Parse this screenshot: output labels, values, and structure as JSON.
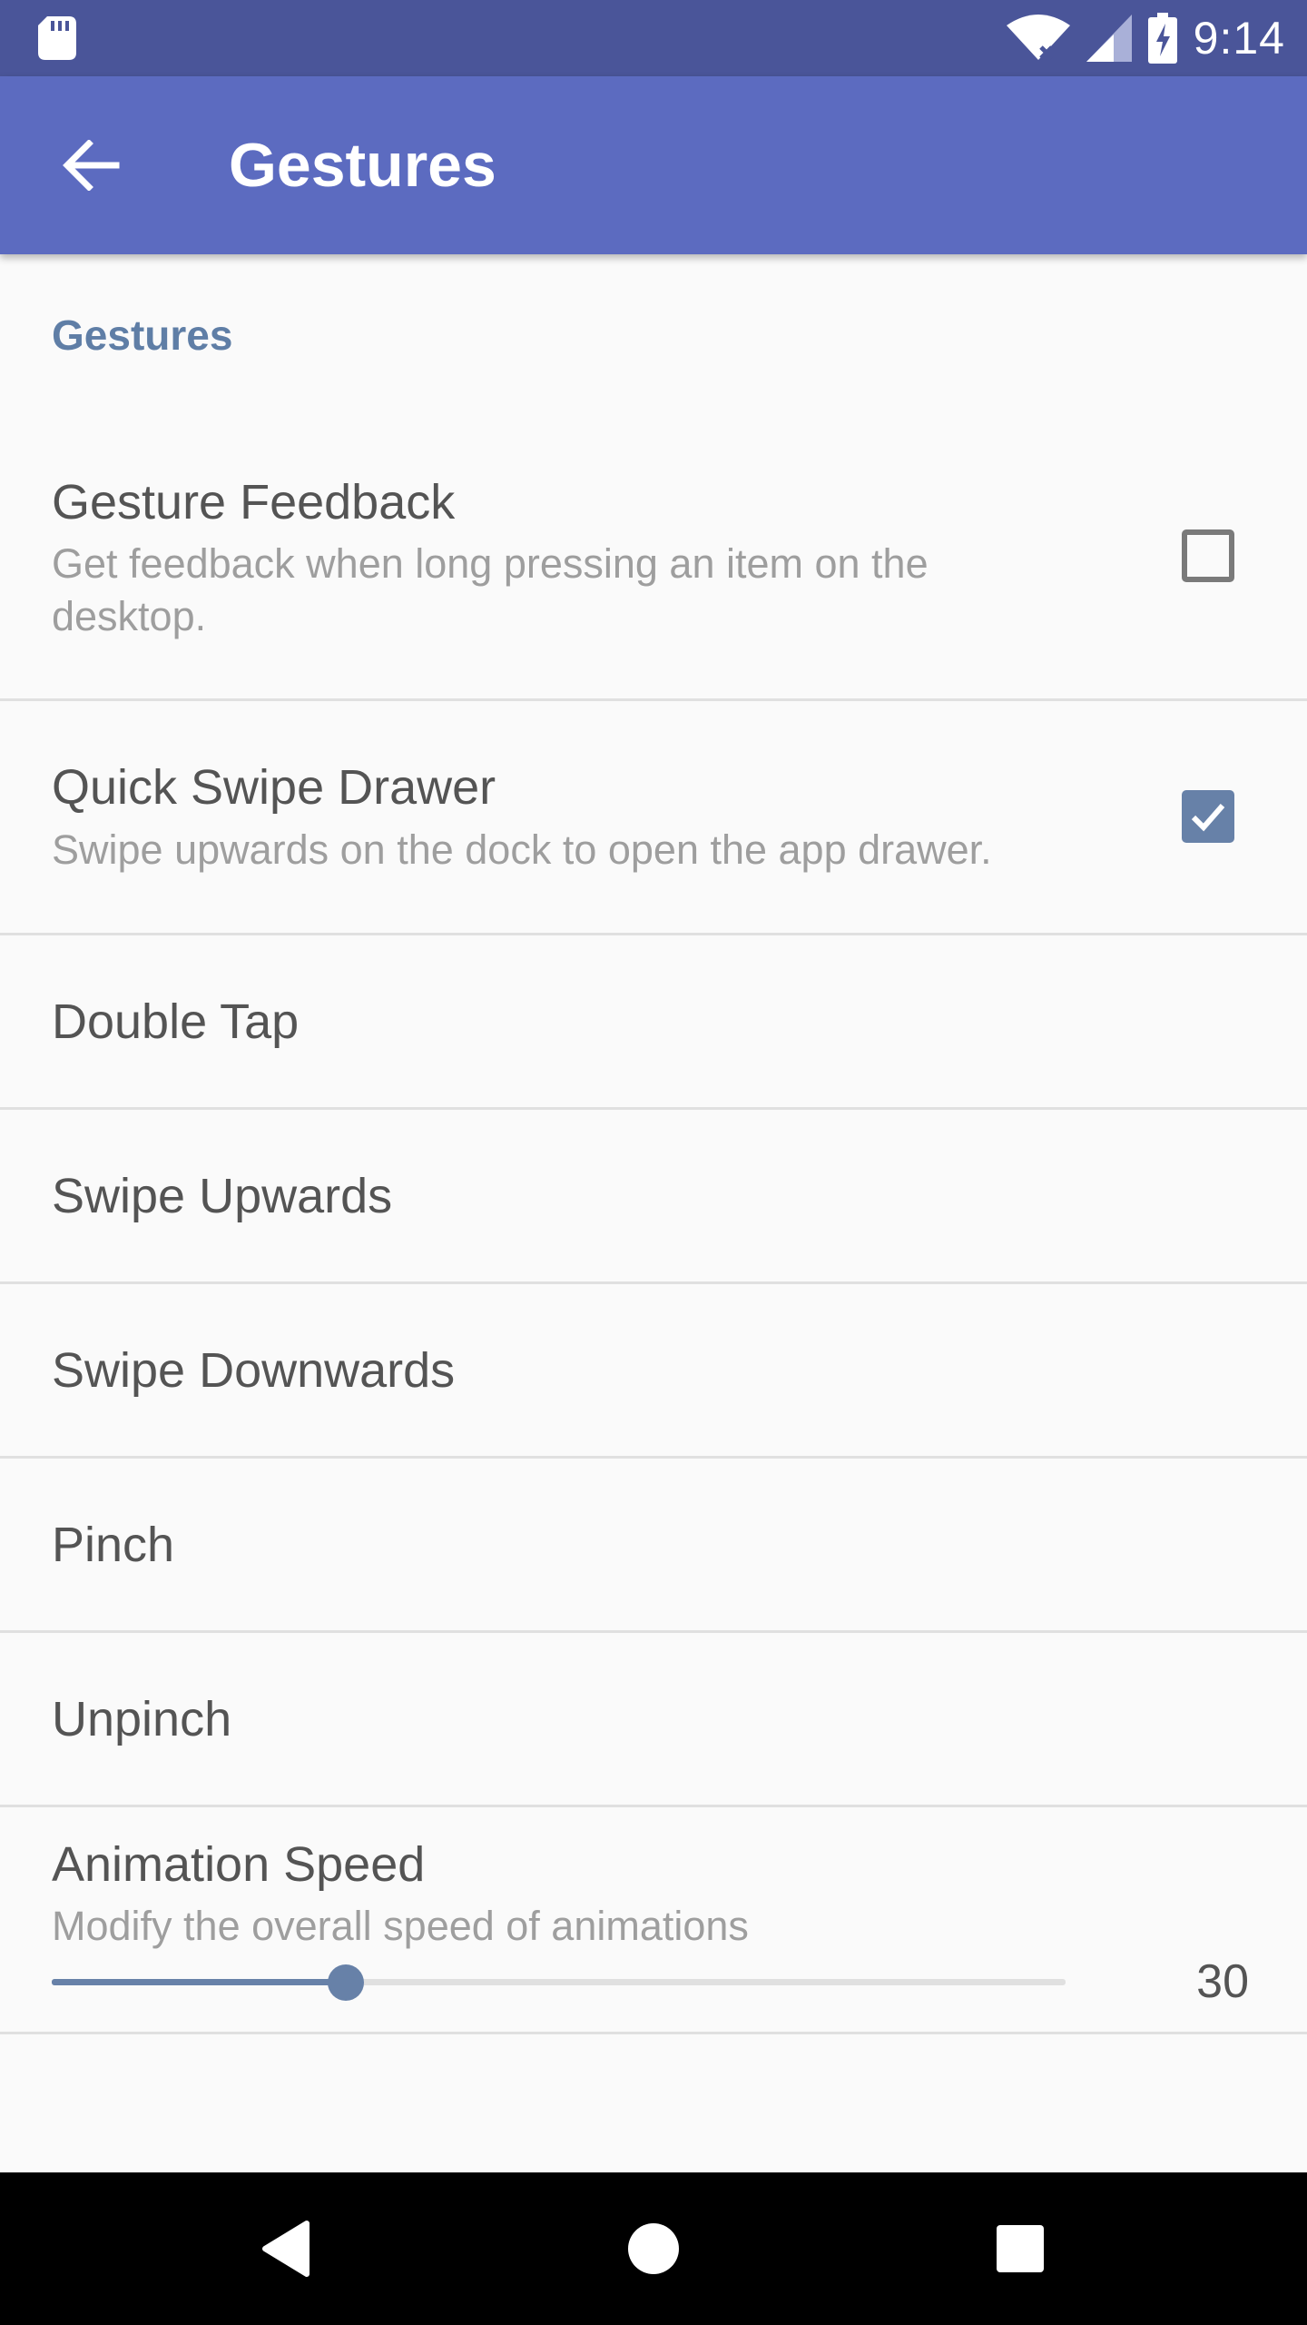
{
  "status_bar": {
    "time": "9:14",
    "icons": [
      "sd-card-icon",
      "wifi-icon",
      "cell-signal-icon",
      "battery-charging-icon"
    ]
  },
  "toolbar": {
    "title": "Gestures",
    "back_icon": "arrow-back-icon"
  },
  "section": {
    "header": "Gestures"
  },
  "preferences": [
    {
      "title": "Gesture Feedback",
      "summary": "Get feedback when long pressing an item on the desktop.",
      "checked": false
    },
    {
      "title": "Quick Swipe Drawer",
      "summary": "Swipe upwards on the dock to open the app drawer.",
      "checked": true
    },
    {
      "title": "Double Tap"
    },
    {
      "title": "Swipe Upwards"
    },
    {
      "title": "Swipe Downwards"
    },
    {
      "title": "Pinch"
    },
    {
      "title": "Unpinch"
    },
    {
      "title": "Animation Speed",
      "summary": "Modify the overall speed of animations",
      "slider_value": "30",
      "slider_fraction": 0.29
    }
  ],
  "nav_bar": {
    "icons": [
      "back-triangle-icon",
      "home-circle-icon",
      "recents-square-icon"
    ]
  },
  "colors": {
    "status_bar": "#4a5599",
    "toolbar": "#5c6bc0",
    "accent": "#6781a8",
    "background": "#fafafa"
  }
}
